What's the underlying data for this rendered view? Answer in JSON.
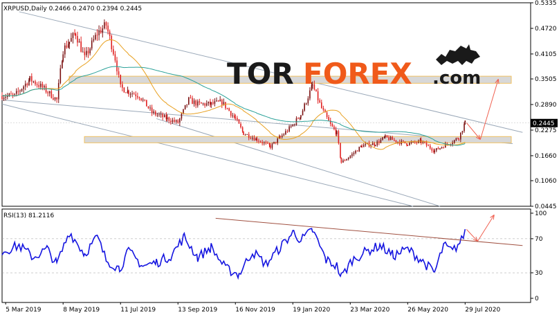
{
  "brand": {
    "part1": "TOR",
    "part2": "FOREX",
    "part3": ".com",
    "color_dark": "#1a1a1a",
    "color_accent": "#f05a1a",
    "icon": "bull-icon"
  },
  "main_panel": {
    "header_text": "XRPUSD,Daily  0.2466 0.2470 0.2394 0.2445",
    "price_ticks": [
      "0.5335",
      "0.4720",
      "0.4105",
      "0.3505",
      "0.2890",
      "0.2275",
      "0.1660",
      "0.1060",
      "0.0445"
    ],
    "current_price_label": "0.2445"
  },
  "rsi_panel": {
    "header_text": "RSI(13) 81.2116",
    "ticks": [
      "100",
      "70",
      "30",
      "0"
    ]
  },
  "x_axis": {
    "labels": [
      "5 Mar 2019",
      "8 May 2019",
      "11 Jul 2019",
      "13 Sep 2019",
      "16 Nov 2019",
      "19 Jan 2020",
      "23 Mar 2020",
      "26 May 2020",
      "29 Jul 2020"
    ]
  },
  "colors": {
    "candle_up": "#7a1010",
    "candle_down": "#e02020",
    "ma_slow": "#2aa198",
    "ma_fast": "#e8a020",
    "rsi_line": "#1414e0",
    "channel": "#9aa8b8",
    "rsi_trendline": "#a05040",
    "forecast_arrow": "#f06050",
    "zone_fill": "#d8d8d8",
    "zone_border": "#f0c060"
  },
  "chart_data": [
    {
      "type": "line",
      "title": "XRPUSD,Daily",
      "series": [
        {
          "name": "XRPUSD",
          "x": [
            "2019-03-01",
            "2019-03-15",
            "2019-04-01",
            "2019-04-15",
            "2019-05-01",
            "2019-05-08",
            "2019-05-15",
            "2019-05-22",
            "2019-06-01",
            "2019-06-15",
            "2019-06-25",
            "2019-07-05",
            "2019-07-11",
            "2019-07-20",
            "2019-08-01",
            "2019-08-15",
            "2019-09-01",
            "2019-09-13",
            "2019-09-25",
            "2019-10-05",
            "2019-10-20",
            "2019-11-01",
            "2019-11-16",
            "2019-11-25",
            "2019-12-10",
            "2019-12-25",
            "2020-01-05",
            "2020-01-19",
            "2020-01-28",
            "2020-02-10",
            "2020-02-20",
            "2020-03-01",
            "2020-03-08",
            "2020-03-13",
            "2020-03-23",
            "2020-04-05",
            "2020-04-20",
            "2020-05-01",
            "2020-05-15",
            "2020-05-26",
            "2020-06-10",
            "2020-06-25",
            "2020-07-05",
            "2020-07-15",
            "2020-07-22",
            "2020-07-29"
          ],
          "values": [
            0.31,
            0.31,
            0.35,
            0.33,
            0.3,
            0.42,
            0.44,
            0.46,
            0.4,
            0.46,
            0.48,
            0.4,
            0.33,
            0.32,
            0.31,
            0.27,
            0.255,
            0.245,
            0.3,
            0.29,
            0.29,
            0.295,
            0.255,
            0.22,
            0.205,
            0.188,
            0.21,
            0.24,
            0.265,
            0.335,
            0.28,
            0.24,
            0.22,
            0.15,
            0.165,
            0.19,
            0.195,
            0.21,
            0.2,
            0.195,
            0.2,
            0.178,
            0.19,
            0.2,
            0.21,
            0.245
          ]
        }
      ],
      "ylim": [
        0.0445,
        0.5335
      ],
      "y_ticks": [
        0.5335,
        0.472,
        0.4105,
        0.3505,
        0.289,
        0.2275,
        0.166,
        0.106,
        0.0445
      ],
      "current_value": 0.2445,
      "resistance_zone": [
        0.34,
        0.357
      ],
      "support_zone": [
        0.197,
        0.212
      ]
    },
    {
      "type": "line",
      "title": "RSI(13) 81.2116",
      "series": [
        {
          "name": "RSI(13)",
          "x": [
            "2019-03-01",
            "2019-03-20",
            "2019-04-05",
            "2019-04-20",
            "2019-05-01",
            "2019-05-15",
            "2019-06-01",
            "2019-06-15",
            "2019-06-25",
            "2019-07-10",
            "2019-07-20",
            "2019-08-05",
            "2019-08-20",
            "2019-09-05",
            "2019-09-20",
            "2019-10-05",
            "2019-10-20",
            "2019-11-05",
            "2019-11-20",
            "2019-12-05",
            "2019-12-20",
            "2020-01-05",
            "2020-01-20",
            "2020-01-28",
            "2020-02-10",
            "2020-02-25",
            "2020-03-08",
            "2020-03-13",
            "2020-03-25",
            "2020-04-10",
            "2020-04-25",
            "2020-05-10",
            "2020-05-26",
            "2020-06-10",
            "2020-06-25",
            "2020-07-05",
            "2020-07-15",
            "2020-07-25",
            "2020-07-29"
          ],
          "values": [
            55,
            62,
            48,
            58,
            40,
            78,
            52,
            72,
            45,
            35,
            55,
            38,
            42,
            50,
            72,
            48,
            60,
            35,
            28,
            55,
            40,
            60,
            78,
            68,
            80,
            45,
            38,
            25,
            45,
            55,
            62,
            50,
            58,
            45,
            30,
            62,
            55,
            68,
            81.21
          ]
        }
      ],
      "ylim": [
        0,
        100
      ],
      "y_ticks": [
        100,
        70,
        30,
        0
      ]
    }
  ]
}
